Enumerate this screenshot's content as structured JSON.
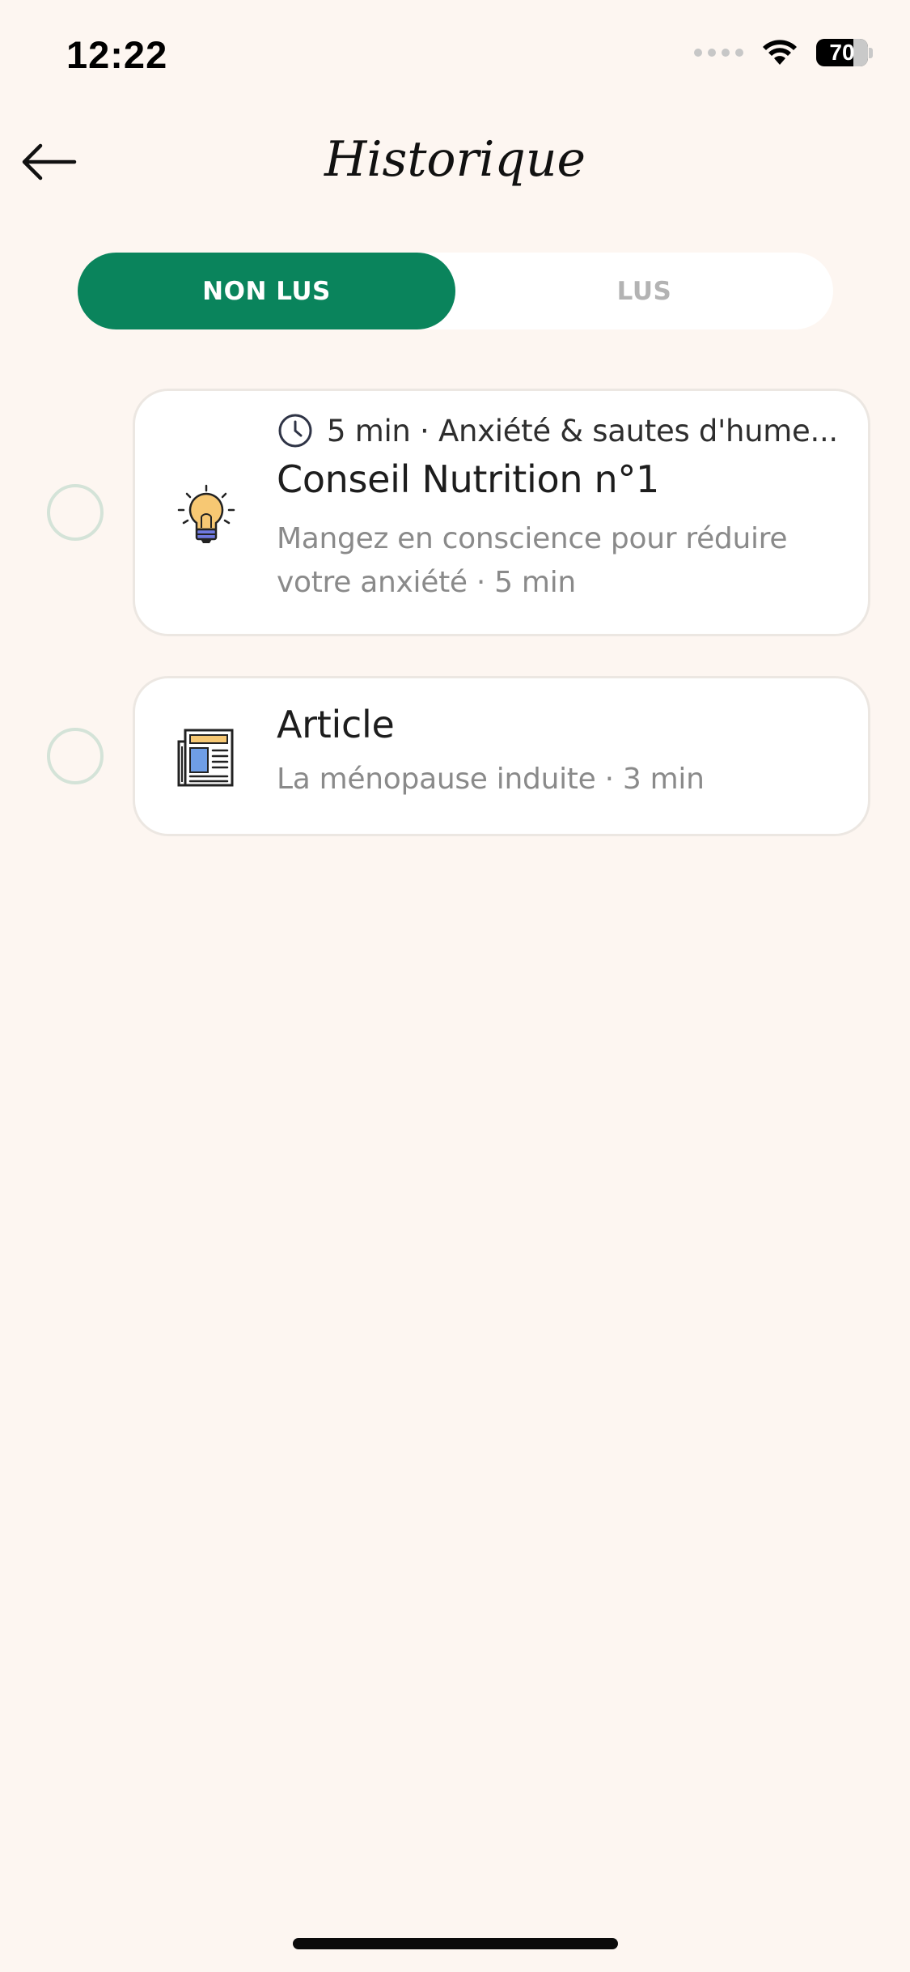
{
  "status_bar": {
    "time": "12:22",
    "battery": "70"
  },
  "header": {
    "title": "Historique"
  },
  "tabs": [
    {
      "label": "NON LUS",
      "active": true
    },
    {
      "label": "LUS",
      "active": false
    }
  ],
  "items": [
    {
      "icon": "lightbulb-icon",
      "meta": "5 min · Anxiété & sautes d'hume...",
      "title": "Conseil Nutrition n°1",
      "description": "Mangez en conscience pour réduire votre anxiété · 5 min"
    },
    {
      "icon": "newspaper-icon",
      "title": "Article",
      "description": "La ménopause induite · 3 min"
    }
  ],
  "colors": {
    "accent": "#0a845c",
    "background": "#fdf6f1",
    "radio_border": "#d4e3d8"
  }
}
